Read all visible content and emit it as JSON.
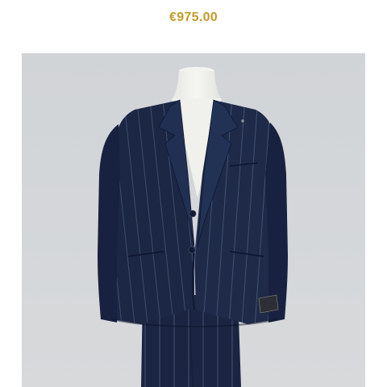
{
  "product": {
    "price": "€975.00",
    "image_subject": "navy-pinstripe-suit-on-mannequin"
  },
  "colors": {
    "price": "#C49A28",
    "background_page": "#FFFFFF",
    "background_photo": "#D3D6D9",
    "suit_navy": "#1E2A47",
    "mannequin": "#F1F1EE"
  }
}
